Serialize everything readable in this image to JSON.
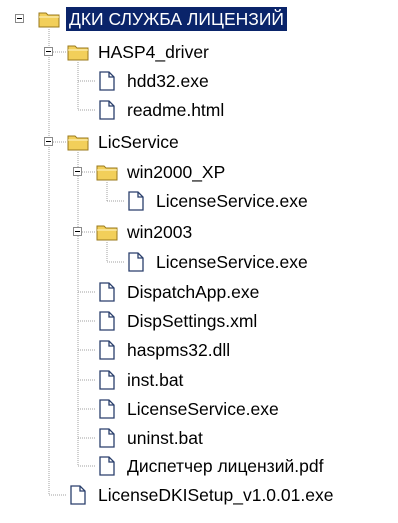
{
  "tree": {
    "selected_index": 0,
    "nodes": [
      {
        "label": "ДКИ СЛУЖБА ЛИЦЕНЗИЙ",
        "type": "folder",
        "depth": 0,
        "expanded": true,
        "name": "root"
      },
      {
        "label": "HASP4_driver",
        "type": "folder",
        "depth": 1,
        "expanded": true,
        "name": "hasp4-driver"
      },
      {
        "label": "hdd32.exe",
        "type": "file",
        "depth": 2,
        "name": "hdd32-exe"
      },
      {
        "label": "readme.html",
        "type": "file",
        "depth": 2,
        "name": "readme-html"
      },
      {
        "label": "LicService",
        "type": "folder",
        "depth": 1,
        "expanded": true,
        "name": "licservice"
      },
      {
        "label": "win2000_XP",
        "type": "folder",
        "depth": 2,
        "expanded": true,
        "name": "win2000-xp"
      },
      {
        "label": "LicenseService.exe",
        "type": "file",
        "depth": 3,
        "name": "licenseservice-exe-xp"
      },
      {
        "label": "win2003",
        "type": "folder",
        "depth": 2,
        "expanded": true,
        "name": "win2003"
      },
      {
        "label": "LicenseService.exe",
        "type": "file",
        "depth": 3,
        "name": "licenseservice-exe-2003"
      },
      {
        "label": "DispatchApp.exe",
        "type": "file",
        "depth": 2,
        "name": "dispatchapp-exe"
      },
      {
        "label": "DispSettings.xml",
        "type": "file",
        "depth": 2,
        "name": "dispsettings-xml"
      },
      {
        "label": "haspms32.dll",
        "type": "file",
        "depth": 2,
        "name": "haspms32-dll"
      },
      {
        "label": "inst.bat",
        "type": "file",
        "depth": 2,
        "name": "inst-bat"
      },
      {
        "label": "LicenseService.exe",
        "type": "file",
        "depth": 2,
        "name": "licenseservice-exe"
      },
      {
        "label": "uninst.bat",
        "type": "file",
        "depth": 2,
        "name": "uninst-bat"
      },
      {
        "label": "Диспетчер лицензий.pdf",
        "type": "file",
        "depth": 2,
        "name": "dispatcher-pdf"
      },
      {
        "label": "LicenseDKISetup_v1.0.01.exe",
        "type": "file",
        "depth": 1,
        "name": "licensedkisetup-exe"
      }
    ],
    "icons": {
      "folder": "folder-icon",
      "file": "document-icon",
      "expander": "collapse-minus-icon"
    },
    "colors": {
      "selection": "#0a246a",
      "folder": "#f2cf5a",
      "connector": "#a0a0a0"
    }
  }
}
